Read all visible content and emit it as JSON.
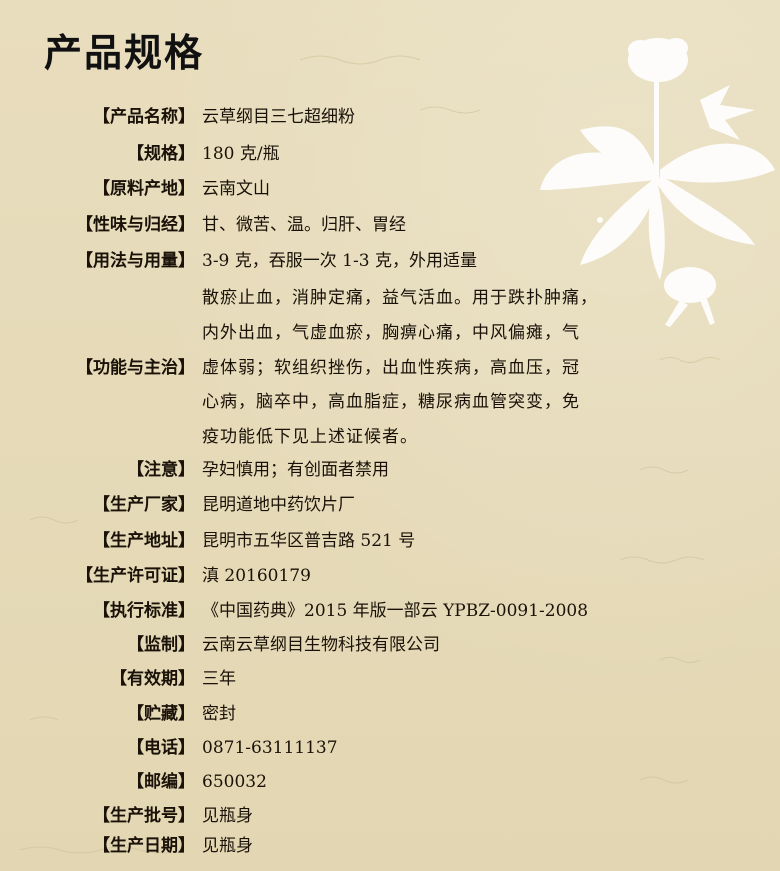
{
  "title": "产品规格",
  "rows": [
    {
      "label": "产品名称",
      "value": "云草纲目三七超细粉"
    },
    {
      "label": "规格",
      "value": "180 克/瓶"
    },
    {
      "label": "原料产地",
      "value": "云南文山"
    },
    {
      "label": "性味与归经",
      "value": "甘、微苦、温。归肝、胃经"
    },
    {
      "label": "用法与用量",
      "value": "3-9 克，吞服一次 1-3 克，外用适量"
    }
  ],
  "function": {
    "label": "功能与主治",
    "lines": [
      "散瘀止血，消肿定痛，益气活血。用于跌扑肿痛，",
      "内外出血，气虚血瘀，胸痹心痛，中风偏瘫，气",
      "虚体弱；软组织挫伤，出血性疾病，高血压，冠",
      "心病，脑卒中，高血脂症，糖尿病血管突变，免",
      "疫功能低下见上述证候者。"
    ]
  },
  "rows2": [
    {
      "label": "注意",
      "value": "孕妇慎用；有创面者禁用"
    },
    {
      "label": "生产厂家",
      "value": "昆明道地中药饮片厂"
    },
    {
      "label": "生产地址",
      "value": "昆明市五华区普吉路 521 号"
    },
    {
      "label": "生产许可证",
      "value": "滇 20160179"
    },
    {
      "label": "执行标准",
      "value": "《中国药典》2015 年版一部云 YPBZ-0091-2008"
    },
    {
      "label": "监制",
      "value": "云南云草纲目生物科技有限公司"
    },
    {
      "label": "有效期",
      "value": "三年"
    },
    {
      "label": "贮藏",
      "value": "密封"
    },
    {
      "label": "电话",
      "value": "0871-63111137"
    },
    {
      "label": "邮编",
      "value": "650032"
    },
    {
      "label": "生产批号",
      "value": "见瓶身"
    },
    {
      "label": "生产日期",
      "value": "见瓶身"
    }
  ],
  "bracket_left": "【",
  "bracket_right": "】",
  "colors": {
    "background": "#e6dbba",
    "text": "#1a1208",
    "flower": "#ffffff"
  },
  "decoration_icon": "panax-notoginseng-flower-icon"
}
